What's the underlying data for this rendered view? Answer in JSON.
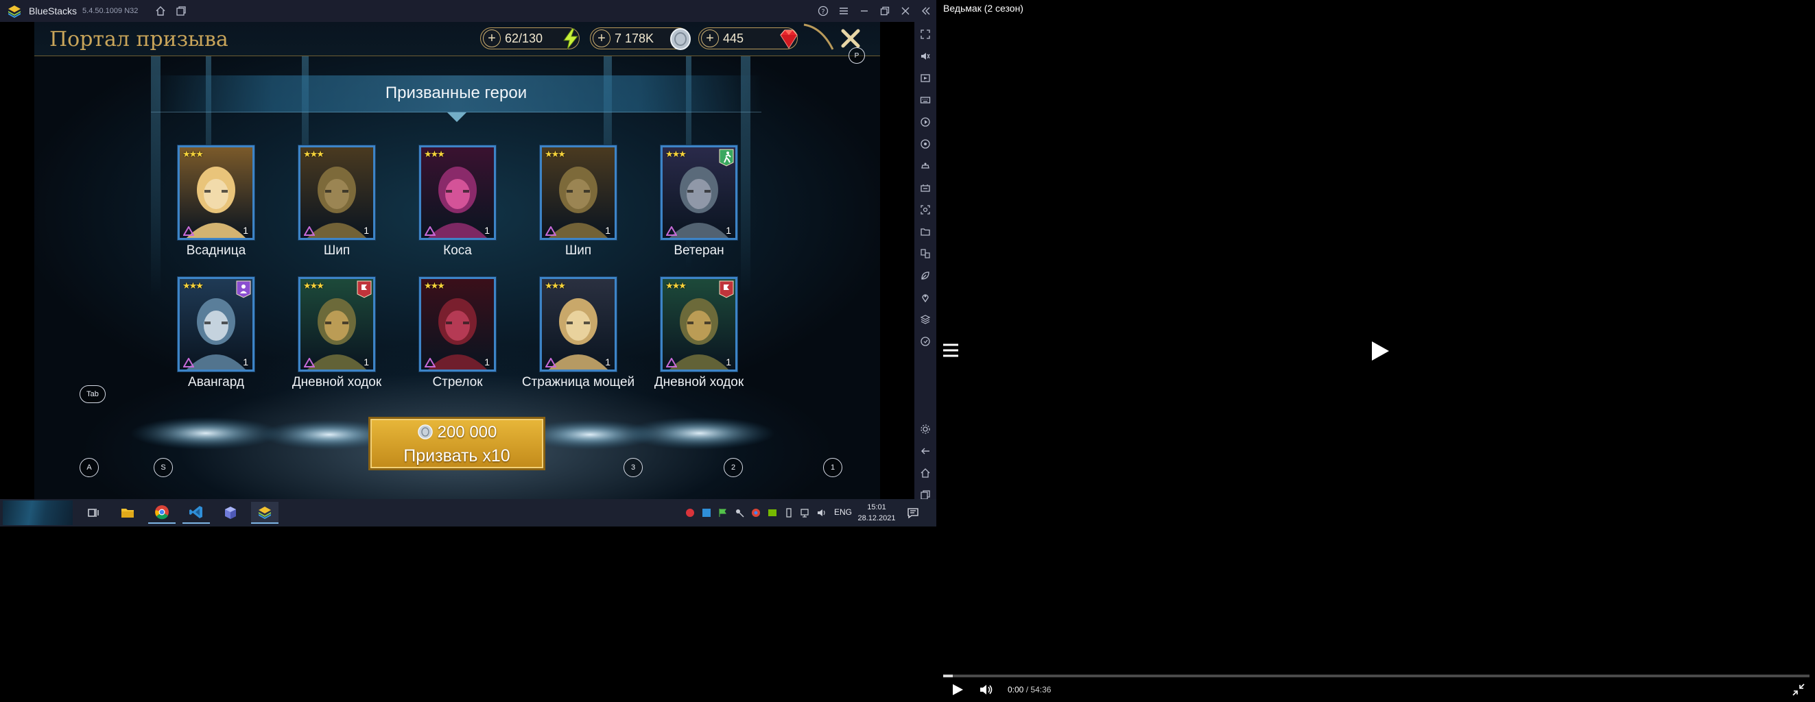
{
  "window": {
    "app_name": "BlueStacks",
    "version": "5.4.50.1009 N32",
    "titlebar_icons": [
      "home-icon",
      "multi-instance-icon",
      "help-icon",
      "menu-icon",
      "minimize-icon",
      "restore-icon",
      "close-icon",
      "collapse-sidebar-icon"
    ]
  },
  "game": {
    "title": "Портал призыва",
    "resources": {
      "energy": "62/130",
      "silver": "7 178K",
      "gems": "445"
    },
    "close_key": "P",
    "banner": "Призванные герои",
    "heroes": [
      {
        "name": "Всадница",
        "level": "1",
        "stars": "★★★"
      },
      {
        "name": "Шип",
        "level": "1",
        "stars": "★★★"
      },
      {
        "name": "Коса",
        "level": "1",
        "stars": "★★★"
      },
      {
        "name": "Шип",
        "level": "1",
        "stars": "★★★"
      },
      {
        "name": "Ветеран",
        "level": "1",
        "stars": "★★★"
      },
      {
        "name": "Авангард",
        "level": "1",
        "stars": "★★★"
      },
      {
        "name": "Дневной ходок",
        "level": "1",
        "stars": "★★★"
      },
      {
        "name": "Стрелок",
        "level": "1",
        "stars": "★★★"
      },
      {
        "name": "Стражница мощей",
        "level": "1",
        "stars": "★★★"
      },
      {
        "name": "Дневной ходок",
        "level": "1",
        "stars": "★★★"
      }
    ],
    "summon": {
      "cost": "200 000",
      "label": "Призвать x10"
    },
    "key_hints": {
      "tab": "Tab",
      "a": "A",
      "s": "S",
      "k3": "3",
      "k2": "2",
      "k1": "1"
    }
  },
  "taskbar": {
    "lang": "ENG",
    "time": "15:01",
    "date": "28.12.2021"
  },
  "player": {
    "title": "Ведьмак (2 сезон)",
    "current_time": "0:00",
    "separator": "/",
    "duration": "54:36",
    "progress_fraction": 0.011
  }
}
